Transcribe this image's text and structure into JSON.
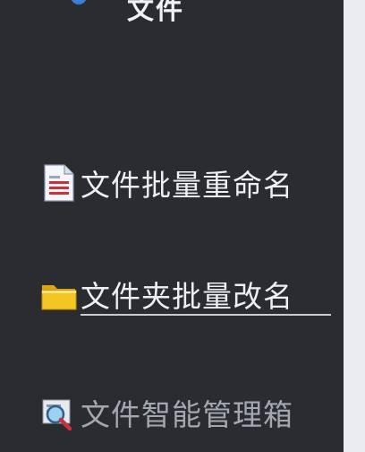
{
  "header": {
    "title": "文件",
    "logo_icon": "app-logo-icon"
  },
  "menu": {
    "items": [
      {
        "label": "文件批量重命名",
        "icon": "document-icon"
      },
      {
        "label": "文件夹批量改名",
        "icon": "folder-icon"
      },
      {
        "label": "文件智能管理箱",
        "icon": "magnifier-icon"
      }
    ]
  },
  "colors": {
    "panel_background": "#2b2c30",
    "page_background": "#e9ebee",
    "label_text": "#eceff3",
    "dim_text": "#a3a8b0",
    "folder_yellow": "#f3c623"
  }
}
